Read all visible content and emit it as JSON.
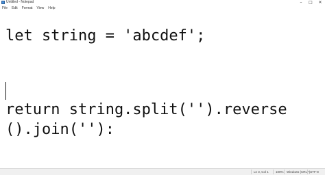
{
  "window": {
    "title": "Untitled - Notepad",
    "app_icon": "notepad-icon",
    "controls": {
      "minimize": "–",
      "maximize": "□",
      "close": "✕"
    }
  },
  "menu": {
    "items": [
      {
        "label": "File"
      },
      {
        "label": "Edit"
      },
      {
        "label": "Format"
      },
      {
        "label": "View"
      },
      {
        "label": "Help"
      }
    ]
  },
  "editor": {
    "lines": [
      "let string = 'abcdef';",
      "return string.split('').reverse",
      "().join(''):"
    ]
  },
  "status": {
    "position": "Ln 3, Col 1",
    "zoom": "100%",
    "line_ending": "Windows (CRLF)",
    "encoding": "UTF-8"
  }
}
